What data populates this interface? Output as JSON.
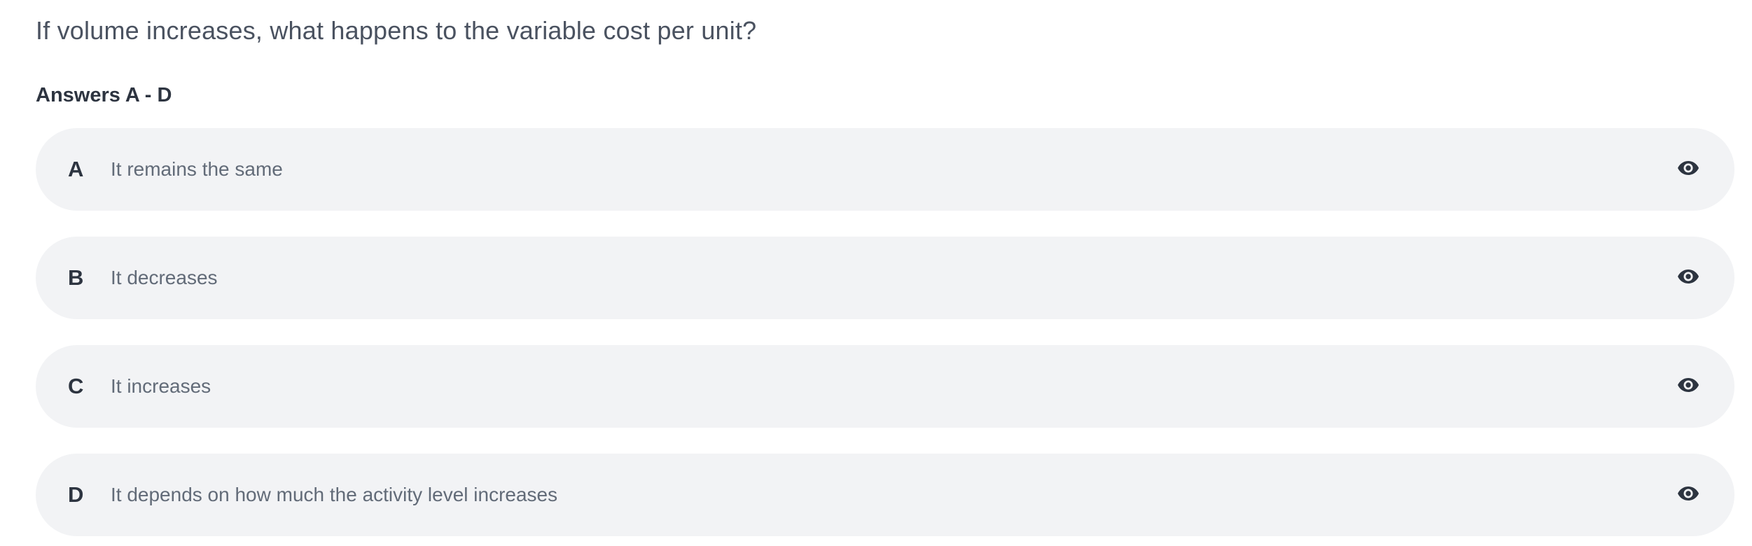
{
  "question": {
    "text": "If volume increases, what happens to the variable cost per unit?"
  },
  "answers_heading": "Answers A - D",
  "answers": [
    {
      "letter": "A",
      "text": "It remains the same",
      "icon": "eye-icon"
    },
    {
      "letter": "B",
      "text": "It decreases",
      "icon": "eye-icon"
    },
    {
      "letter": "C",
      "text": "It increases",
      "icon": "eye-icon"
    },
    {
      "letter": "D",
      "text": "It depends on how much the activity level increases",
      "icon": "eye-icon"
    }
  ],
  "colors": {
    "answer_background": "#f2f3f5",
    "heading_text": "#2d3440",
    "body_text": "#626b78",
    "icon": "#2d3440"
  }
}
